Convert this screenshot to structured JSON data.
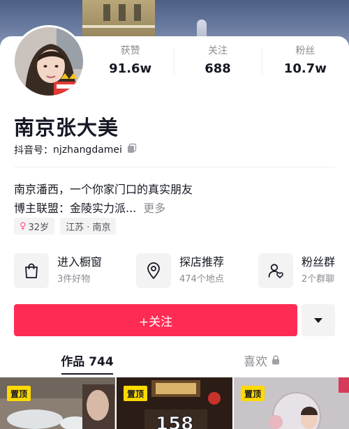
{
  "profile": {
    "name": "南京张大美",
    "douyin_id_label": "抖音号：",
    "douyin_id": "njzhangdamei"
  },
  "stats": [
    {
      "label": "获赞",
      "value": "91.6w"
    },
    {
      "label": "关注",
      "value": "688"
    },
    {
      "label": "粉丝",
      "value": "10.7w"
    }
  ],
  "bio": {
    "line1": "南京潘西，一个你家门口的真实朋友",
    "line2": "博主联盟：金陵实力派...",
    "more": "更多"
  },
  "tags": {
    "age": "32岁",
    "location": "江苏 · 南京"
  },
  "shortcuts": [
    {
      "title": "进入橱窗",
      "subtitle": "3件好物",
      "icon": "shopping-bag-icon"
    },
    {
      "title": "探店推荐",
      "subtitle": "474个地点",
      "icon": "location-pin-icon"
    },
    {
      "title": "粉丝群",
      "subtitle": "2个群聊",
      "icon": "fan-group-icon"
    }
  ],
  "actions": {
    "follow": "+关注"
  },
  "tabs": {
    "works": "作品 744",
    "likes": "喜欢"
  },
  "thumbnails": [
    {
      "pin": "置顶"
    },
    {
      "pin": "置顶",
      "overlay_text": "158"
    },
    {
      "pin": "置顶"
    }
  ],
  "colors": {
    "accent": "#fe2c55",
    "pin": "#fdd900"
  }
}
